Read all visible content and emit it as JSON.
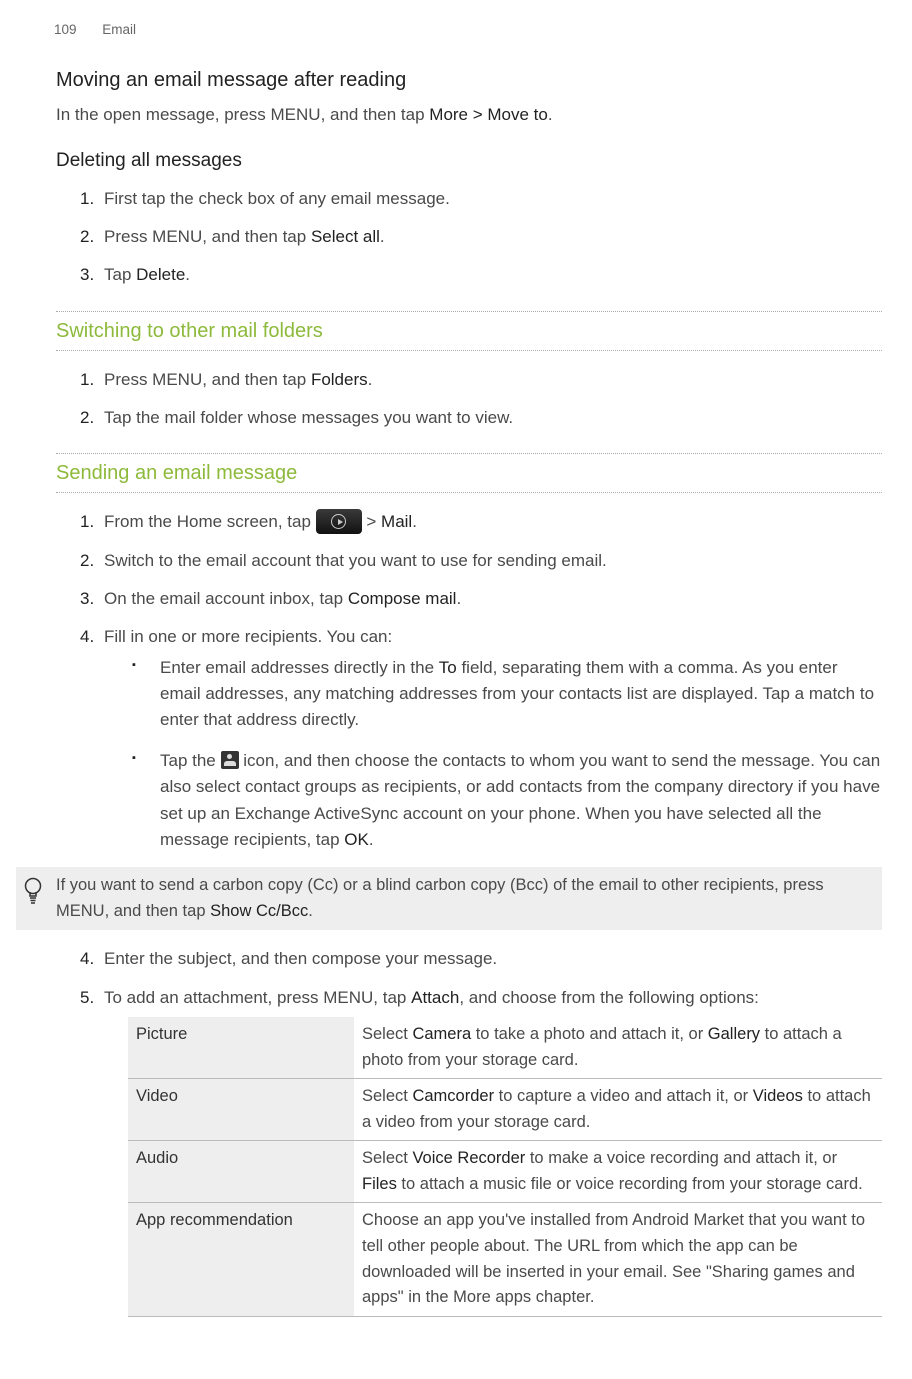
{
  "header": {
    "page": "109",
    "section": "Email"
  },
  "sec1": {
    "title": "Moving an email message after reading",
    "body_pre": "In the open message, press MENU, and then tap ",
    "body_bold": "More > Move to",
    "body_post": "."
  },
  "sec2": {
    "title": "Deleting all messages",
    "item1": "First tap the check box of any email message.",
    "item2_pre": "Press MENU, and then tap ",
    "item2_bold": "Select all",
    "item2_post": ".",
    "item3_pre": "Tap ",
    "item3_bold": "Delete",
    "item3_post": "."
  },
  "sec3": {
    "title": "Switching to other mail folders",
    "item1_pre": "Press MENU, and then tap ",
    "item1_bold": "Folders",
    "item1_post": ".",
    "item2": "Tap the mail folder whose messages you want to view."
  },
  "sec4": {
    "title": "Sending an email message",
    "i1_pre": "From the Home screen, tap ",
    "i1_mid": " > ",
    "i1_bold": "Mail",
    "i1_post": ".",
    "i2": "Switch to the email account that you want to use for sending email.",
    "i3_pre": "On the email account inbox, tap ",
    "i3_bold": "Compose mail",
    "i3_post": ".",
    "i4": "Fill in one or more recipients. You can:",
    "b1_pre": "Enter email addresses directly in the ",
    "b1_bold": "To",
    "b1_post": " field, separating them with a comma. As you enter email addresses, any matching addresses from your contacts list are displayed. Tap a match to enter that address directly.",
    "b2_pre": "Tap the ",
    "b2_mid": " icon, and then choose the contacts to whom you want to send the message. You can also select contact groups as recipients, or add contacts from the company directory if you have set up an Exchange ActiveSync account on your phone. When you have selected all the message recipients, tap ",
    "b2_bold": "OK",
    "b2_post": ".",
    "tip_pre": "If you want to send a carbon copy (Cc) or a blind carbon copy (Bcc) of the email to other recipients, press MENU, and then tap ",
    "tip_bold": "Show Cc/Bcc",
    "tip_post": ".",
    "i4b": "Enter the subject, and then compose your message.",
    "i5_pre": "To add an attachment, press MENU, tap ",
    "i5_bold": "Attach",
    "i5_post": ", and choose from the following options:"
  },
  "table": {
    "r1l": "Picture",
    "r1_pre": "Select ",
    "r1_b1": "Camera",
    "r1_mid": " to take a photo and attach it, or ",
    "r1_b2": "Gallery",
    "r1_post": " to attach a photo from your storage card.",
    "r2l": "Video",
    "r2_pre": "Select ",
    "r2_b1": "Camcorder",
    "r2_mid": " to capture a video and attach it, or ",
    "r2_b2": "Videos",
    "r2_post": " to attach a video from your storage card.",
    "r3l": "Audio",
    "r3_pre": "Select ",
    "r3_b1": "Voice Recorder",
    "r3_mid": " to make a voice recording and attach it, or ",
    "r3_b2": "Files",
    "r3_post": " to attach a music file or voice recording from your storage card.",
    "r4l": "App recommendation",
    "r4": "Choose an app you've installed from Android Market that you want to tell other people about. The URL from which the app can be downloaded will be inserted in your email. See \"Sharing games and apps\" in the More apps chapter."
  },
  "nums": {
    "n1": "1.",
    "n2": "2.",
    "n3": "3.",
    "n4": "4.",
    "n5": "5."
  }
}
